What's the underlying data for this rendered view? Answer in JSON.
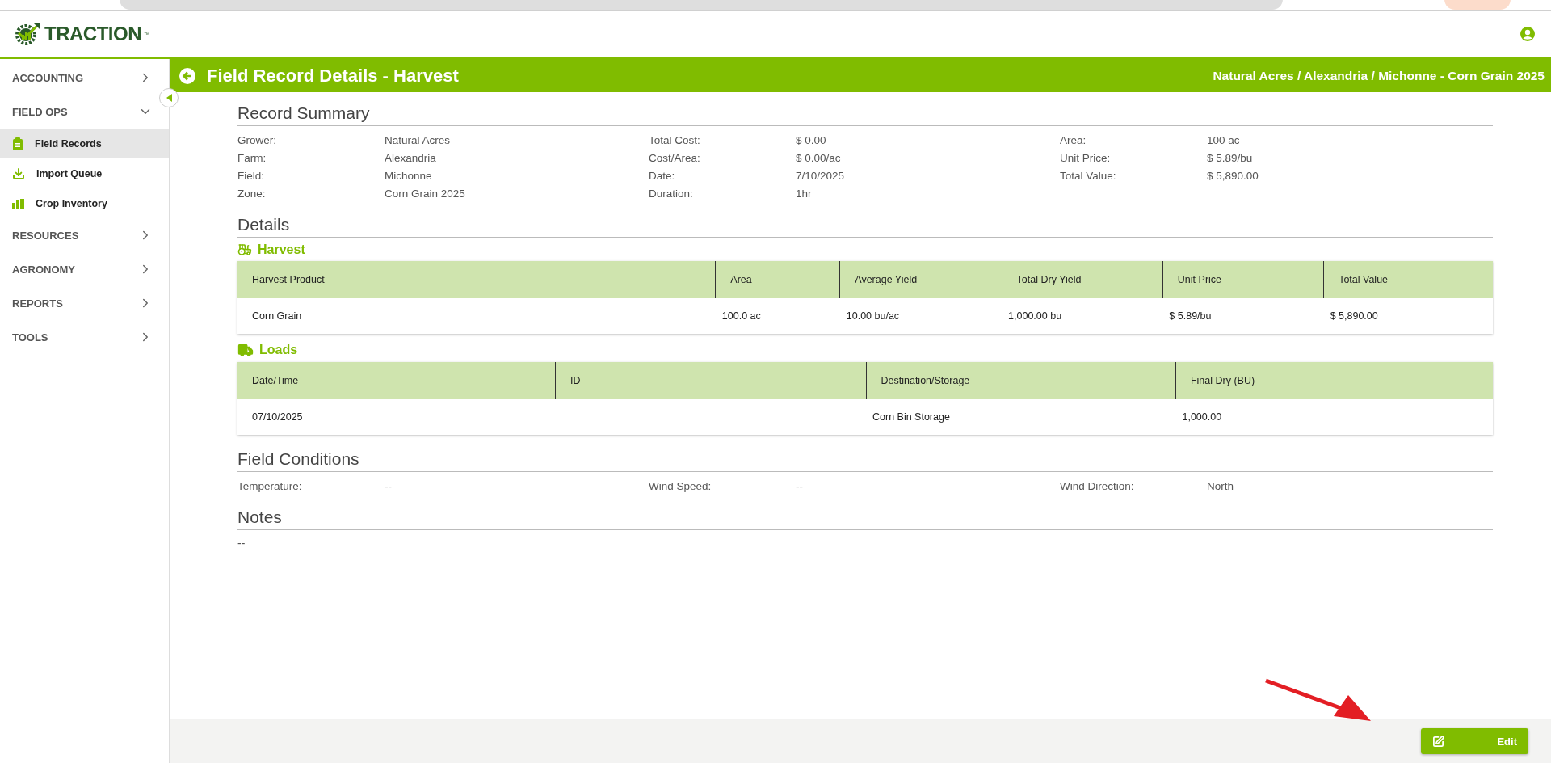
{
  "logo": {
    "text": "TRACTION",
    "trademark": "™"
  },
  "sidebar": {
    "items": [
      {
        "label": "ACCOUNTING",
        "expanded": false
      },
      {
        "label": "FIELD OPS",
        "expanded": true,
        "children": [
          {
            "label": "Field Records",
            "kind": "clipboard",
            "selected": true
          },
          {
            "label": "Import Queue",
            "kind": "import",
            "selected": false
          },
          {
            "label": "Crop Inventory",
            "kind": "inventory",
            "selected": false
          }
        ]
      },
      {
        "label": "RESOURCES",
        "expanded": false
      },
      {
        "label": "AGRONOMY",
        "expanded": false
      },
      {
        "label": "REPORTS",
        "expanded": false
      },
      {
        "label": "TOOLS",
        "expanded": false
      }
    ]
  },
  "page_header": {
    "title": "Field Record Details - Harvest",
    "breadcrumb": "Natural Acres / Alexandria / Michonne - Corn Grain 2025"
  },
  "record_summary": {
    "title": "Record Summary",
    "fields": [
      {
        "label": "Grower:",
        "value": "Natural Acres"
      },
      {
        "label": "Total Cost:",
        "value": "$ 0.00"
      },
      {
        "label": "Area:",
        "value": "100 ac"
      },
      {
        "label": "Farm:",
        "value": "Alexandria"
      },
      {
        "label": "Cost/Area:",
        "value": "$ 0.00/ac"
      },
      {
        "label": "Unit Price:",
        "value": "$ 5.89/bu"
      },
      {
        "label": "Field:",
        "value": "Michonne"
      },
      {
        "label": "Date:",
        "value": "7/10/2025"
      },
      {
        "label": "Total Value:",
        "value": "$ 5,890.00"
      },
      {
        "label": "Zone:",
        "value": "Corn Grain 2025"
      },
      {
        "label": "Duration:",
        "value": "1hr"
      }
    ]
  },
  "details": {
    "title": "Details",
    "tables": [
      {
        "kind": "harvest",
        "title": "Harvest",
        "columns": [
          "Harvest Product",
          "Area",
          "Average Yield",
          "Total Dry Yield",
          "Unit Price",
          "Total Value"
        ],
        "rows": [
          [
            "Corn Grain",
            "100.0 ac",
            "10.00 bu/ac",
            "1,000.00 bu",
            "$ 5.89/bu",
            "$ 5,890.00"
          ]
        ]
      },
      {
        "kind": "loads",
        "title": "Loads",
        "columns": [
          "Date/Time",
          "ID",
          "Destination/Storage",
          "Final Dry (BU)"
        ],
        "rows": [
          [
            "07/10/2025",
            "",
            "Corn Bin Storage",
            "1,000.00"
          ]
        ]
      }
    ]
  },
  "field_conditions": {
    "title": "Field Conditions",
    "fields": [
      {
        "label": "Temperature:",
        "value": "--"
      },
      {
        "label": "Wind Speed:",
        "value": "--"
      },
      {
        "label": "Wind Direction:",
        "value": "North"
      }
    ]
  },
  "notes": {
    "title": "Notes",
    "text": "--"
  },
  "footer": {
    "edit_button": "Edit"
  }
}
